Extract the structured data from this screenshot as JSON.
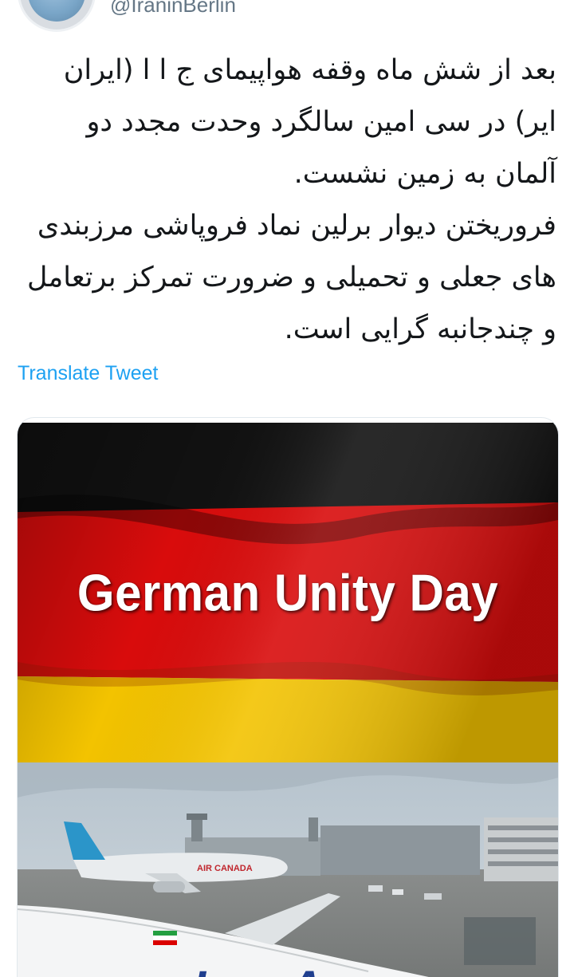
{
  "tweet": {
    "handle": "@IraninBerlin",
    "paragraph_1": "بعد از شش ماه وقفه هواپیمای ج ا ا (ایران ایر) در سی امین سالگرد وحدت مجدد دو آلمان به زمین نشست.",
    "paragraph_2": "فروریختن دیوار برلین نماد فروپاشی مرزبندی های جعلی و تحمیلی و  ضرورت تمرکز برتعامل و  چندجانبه گرایی است.",
    "translate_label": "Translate Tweet"
  },
  "media": {
    "overlay_title": "German Unity Day",
    "flag_colors": {
      "black": "#111111",
      "red": "#d90c0c",
      "gold": "#f3c300"
    },
    "aircraft_livery_1": "AIR CANADA",
    "aircraft_livery_2": "Iran A"
  },
  "colors": {
    "link": "#1da1f2",
    "text": "#14171a",
    "secondary": "#657786",
    "border": "#e1e8ed"
  }
}
